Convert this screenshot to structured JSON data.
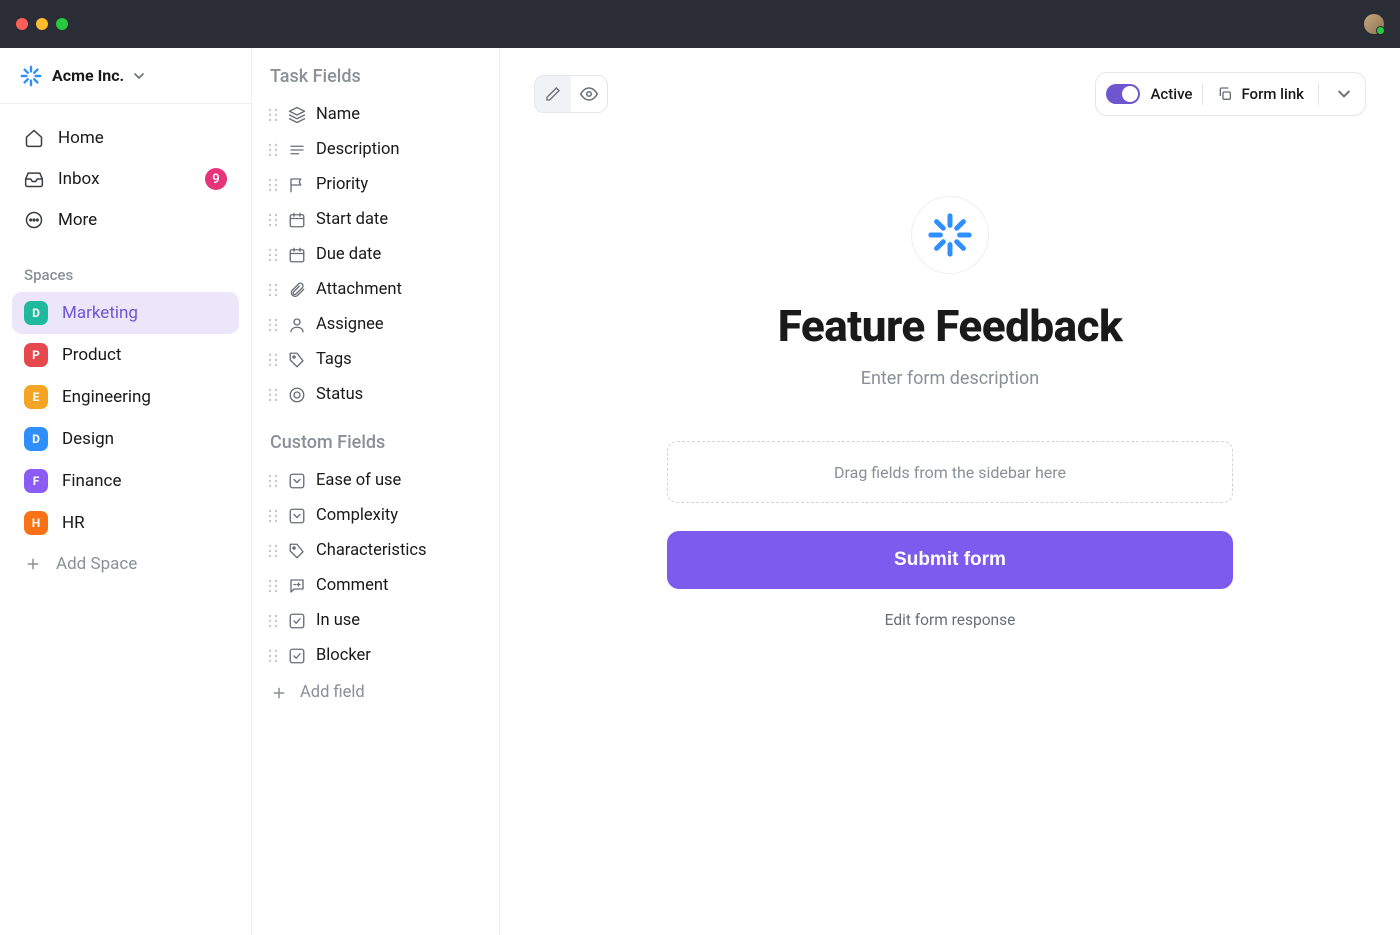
{
  "workspace": {
    "name": "Acme Inc."
  },
  "nav": {
    "home": "Home",
    "inbox": "Inbox",
    "inbox_badge": "9",
    "more": "More"
  },
  "spaces_label": "Spaces",
  "spaces": [
    {
      "letter": "D",
      "label": "Marketing",
      "color": "#20b89f",
      "active": true
    },
    {
      "letter": "P",
      "label": "Product",
      "color": "#e5484d"
    },
    {
      "letter": "E",
      "label": "Engineering",
      "color": "#f5a524"
    },
    {
      "letter": "D",
      "label": "Design",
      "color": "#2f8fff"
    },
    {
      "letter": "F",
      "label": "Finance",
      "color": "#8b5cf6"
    },
    {
      "letter": "H",
      "label": "HR",
      "color": "#f97316"
    }
  ],
  "add_space": "Add Space",
  "task_fields_label": "Task Fields",
  "task_fields": [
    {
      "label": "Name",
      "icon": "layers"
    },
    {
      "label": "Description",
      "icon": "text"
    },
    {
      "label": "Priority",
      "icon": "flag"
    },
    {
      "label": "Start date",
      "icon": "calendar"
    },
    {
      "label": "Due date",
      "icon": "calendar"
    },
    {
      "label": "Attachment",
      "icon": "paperclip"
    },
    {
      "label": "Assignee",
      "icon": "person"
    },
    {
      "label": "Tags",
      "icon": "tag"
    },
    {
      "label": "Status",
      "icon": "target"
    }
  ],
  "custom_fields_label": "Custom Fields",
  "custom_fields": [
    {
      "label": "Ease of use",
      "icon": "dropdown"
    },
    {
      "label": "Complexity",
      "icon": "dropdown"
    },
    {
      "label": "Characteristics",
      "icon": "tag"
    },
    {
      "label": "Comment",
      "icon": "comment"
    },
    {
      "label": "In use",
      "icon": "checkbox"
    },
    {
      "label": "Blocker",
      "icon": "checkbox"
    }
  ],
  "add_field": "Add field",
  "toolbar": {
    "active": "Active",
    "form_link": "Form link"
  },
  "form": {
    "title": "Feature Feedback",
    "desc_placeholder": "Enter form description",
    "drop_hint": "Drag fields from the sidebar here",
    "submit": "Submit form",
    "edit_response": "Edit form response"
  }
}
